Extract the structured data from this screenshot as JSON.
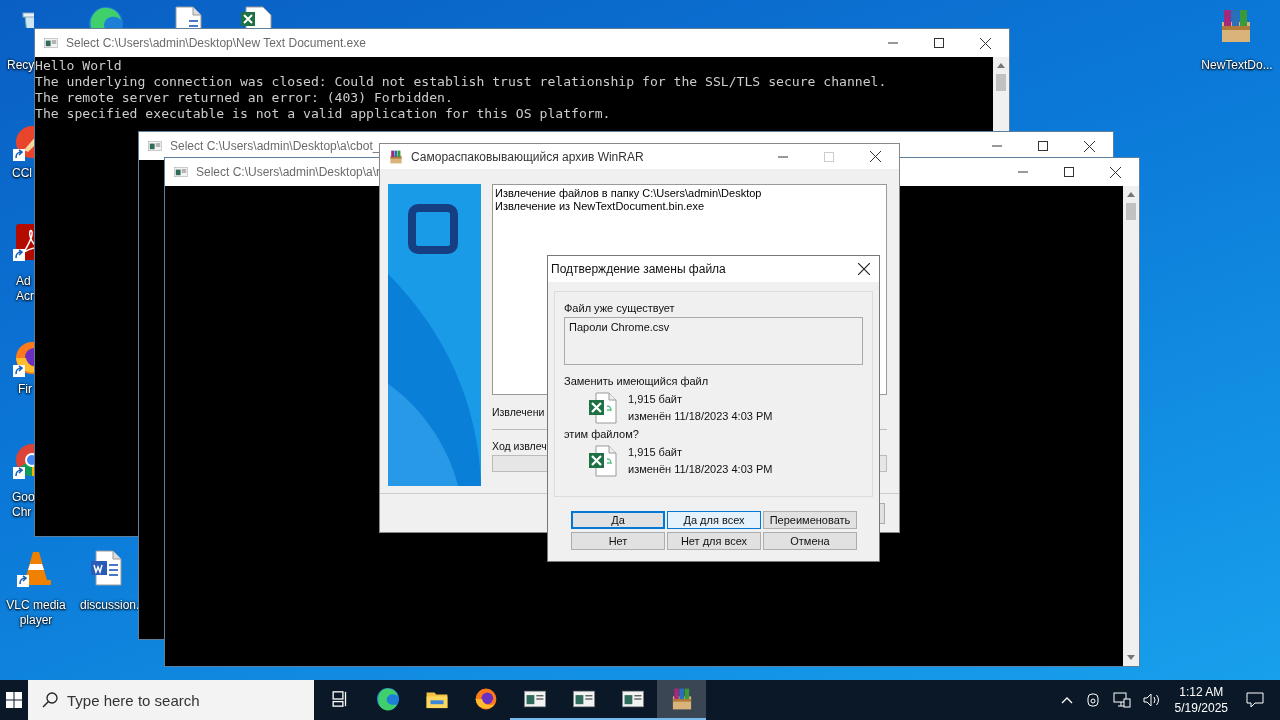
{
  "desktop_icons": [
    {
      "kind": "recycle-bin",
      "label": "Recy"
    },
    {
      "kind": "edge"
    },
    {
      "kind": "document"
    },
    {
      "kind": "spreadsheet"
    },
    {
      "kind": "ccleaner",
      "label": "CCl",
      "shortcut": true
    },
    {
      "kind": "acrobat",
      "label": "Ad\nAcr",
      "shortcut": true
    },
    {
      "kind": "firefox",
      "label": "Fir",
      "shortcut": true
    },
    {
      "kind": "chrome",
      "label": "Goo\nChr",
      "shortcut": true
    },
    {
      "kind": "vlc",
      "label": "VLC media\nplayer",
      "shortcut": true
    },
    {
      "kind": "word",
      "label": "discussion.",
      "shortcut": false
    },
    {
      "kind": "winrar",
      "label": "NewTextDo...",
      "shortcut": false
    }
  ],
  "consoles": [
    {
      "title": "Select C:\\Users\\admin\\Desktop\\New Text Document.exe",
      "lines": [
        "Hello World",
        "The underlying connection was closed: Could not establish trust relationship for the SSL/TLS secure channel.",
        "The remote server returned an error: (403) Forbidden.",
        "The specified executable is not a valid application for this OS platform."
      ]
    },
    {
      "title": "Select C:\\Users\\admin\\Desktop\\a\\cbot_"
    },
    {
      "title": "Select C:\\Users\\admin\\Desktop\\a\\r"
    }
  ],
  "winrar": {
    "title": "Самораспаковывающийся архив WinRAR",
    "maximize_disabled": true,
    "log": [
      "Извлечение файлов в папку C:\\Users\\admin\\Desktop",
      "Извлечение из NewTextDocument.bin.exe"
    ],
    "status_label": "Извлечени",
    "progress_label": "Ход извлеч",
    "progress": {
      "level": 0
    }
  },
  "dialog": {
    "title": "Подтверждение замены файла",
    "exists_label": "Файл уже существует",
    "file_name": "Пароли Chrome.csv",
    "replace_label": "Заменить имеющийся файл",
    "existing": {
      "size": "1,915 байт",
      "modified": "изменён 11/18/2023 4:03 PM"
    },
    "with_label": "этим файлом?",
    "incoming": {
      "size": "1,915 байт",
      "modified": "изменён 11/18/2023 4:03 PM"
    },
    "buttons": [
      {
        "label": "Да",
        "focused": true,
        "hovered": false
      },
      {
        "label": "Да для всех",
        "focused": false,
        "hovered": true
      },
      {
        "label": "Переименовать",
        "focused": false,
        "hovered": false
      },
      {
        "label": "Нет",
        "focused": false,
        "hovered": false
      },
      {
        "label": "Нет для всех",
        "focused": false,
        "hovered": false
      },
      {
        "label": "Отмена",
        "focused": false,
        "hovered": false
      }
    ]
  },
  "taskbar": {
    "search": {
      "placeholder": "Type here to search"
    },
    "apps": [
      {
        "kind": "taskview",
        "running": false,
        "active": false
      },
      {
        "kind": "edge",
        "running": false,
        "active": false
      },
      {
        "kind": "explorer",
        "running": false,
        "active": false
      },
      {
        "kind": "firefox",
        "running": false,
        "active": false
      },
      {
        "kind": "console",
        "running": true,
        "active": false
      },
      {
        "kind": "console",
        "running": true,
        "active": false
      },
      {
        "kind": "console",
        "running": true,
        "active": false
      },
      {
        "kind": "winrar",
        "running": true,
        "active": true
      }
    ],
    "clock": {
      "time": "1:12 AM",
      "date": "5/19/2025"
    }
  }
}
